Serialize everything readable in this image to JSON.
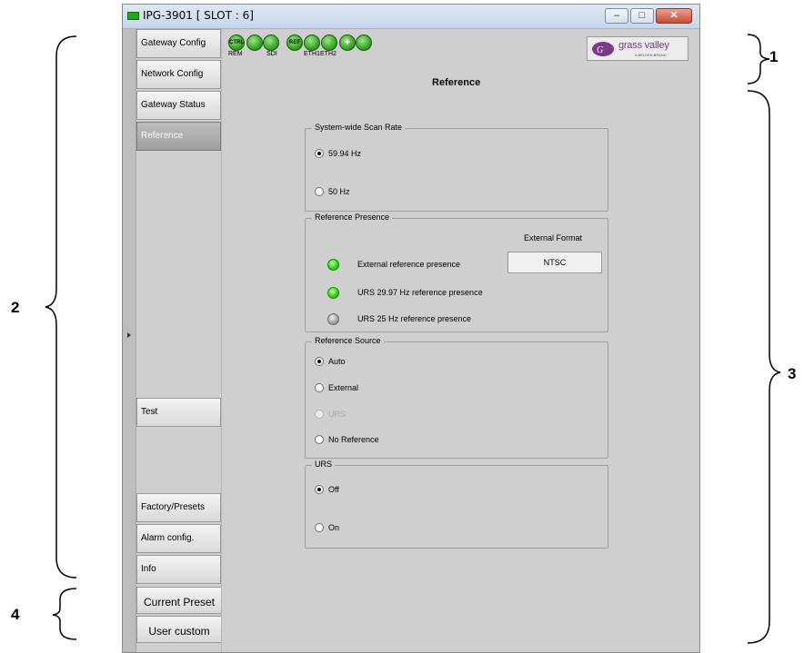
{
  "callouts": [
    "1",
    "2",
    "3",
    "4"
  ],
  "window": {
    "title": "IPG-3901   [ SLOT : 6]",
    "min_label": "–",
    "max_label": "□",
    "close_label": "✕"
  },
  "toolbar": {
    "icons": [
      {
        "name": "ctrl-icon",
        "text": "CTRL",
        "label": "REM"
      },
      {
        "name": "status-icon",
        "text": "",
        "label": ""
      },
      {
        "name": "sdi-icon",
        "text": "",
        "label": "SDI"
      },
      {
        "name": "ref-icon",
        "text": "REF",
        "label": ""
      },
      {
        "name": "eth1-icon",
        "text": "",
        "label": "ETH1"
      },
      {
        "name": "eth2-icon",
        "text": "",
        "label": "ETH2"
      },
      {
        "name": "add-icon",
        "text": "+",
        "label": ""
      },
      {
        "name": "refresh-icon",
        "text": "",
        "label": ""
      }
    ],
    "logo_text": "grass valley",
    "logo_sub": "A BELDEN BRAND"
  },
  "tabs": {
    "gateway_config": "Gateway Config",
    "network_config": "Network Config",
    "gateway_status": "Gateway Status",
    "reference": "Reference",
    "test": "Test",
    "factory_presets": "Factory/Presets",
    "alarm_config": "Alarm config.",
    "info": "Info",
    "current_preset": "Current Preset",
    "user_custom": "User custom"
  },
  "panel": {
    "title": "Reference",
    "scan_rate": {
      "title": "System-wide Scan Rate",
      "options": [
        "59.94 Hz",
        "50 Hz"
      ],
      "selected": "59.94 Hz"
    },
    "presence": {
      "title": "Reference Presence",
      "external_format_label": "External Format",
      "external_format_value": "NTSC",
      "items": [
        {
          "label": "External reference presence",
          "state": "green"
        },
        {
          "label": "URS 29.97 Hz reference presence",
          "state": "green"
        },
        {
          "label": "URS 25 Hz reference presence",
          "state": "gray"
        }
      ]
    },
    "source": {
      "title": "Reference Source",
      "options": [
        "Auto",
        "External",
        "URS",
        "No Reference"
      ],
      "selected": "Auto",
      "disabled": [
        "URS"
      ]
    },
    "urs": {
      "title": "URS",
      "options": [
        "Off",
        "On"
      ],
      "selected": "Off"
    }
  },
  "colors": {
    "led_on": "#2bcf10",
    "led_off": "#9a9a9a",
    "active_tab": "#a8a8a8",
    "brand": "#7e3a8a"
  }
}
